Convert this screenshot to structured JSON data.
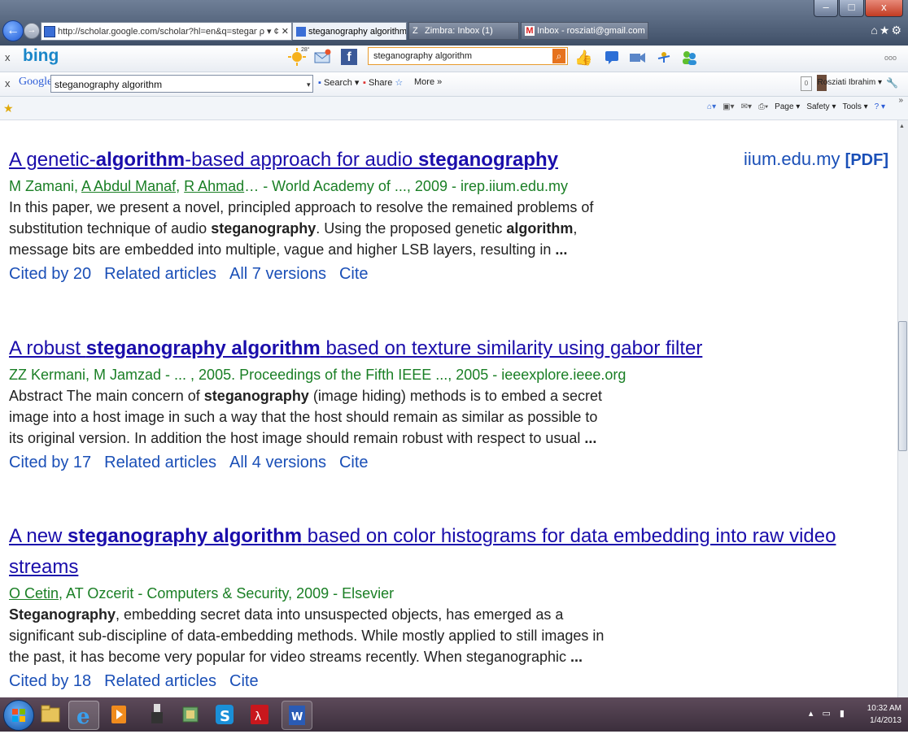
{
  "browser": {
    "address_url": "http://scholar.google.com/scholar?hl=en&q=steganography+alg",
    "address_controls": "ρ ▾ ¢ ✕",
    "tabs": [
      {
        "label": "steganography algorithm - ...",
        "active": true
      },
      {
        "label": "Zimbra: Inbox (1)",
        "active": false
      },
      {
        "label": "Inbox - rosziati@gmail.com - ...",
        "active": false
      }
    ],
    "window_controls": {
      "minimize": "–",
      "maximize": "□",
      "close": "x"
    }
  },
  "bing_toolbar": {
    "logo": "bing",
    "weather_temp": "28°",
    "search_value": "steganography algorithm",
    "close_label": "x",
    "more": "ooo"
  },
  "google_toolbar": {
    "close_label": "x",
    "logo": "Google",
    "search_value": "steganography algorithm",
    "search_label": "Search ▾",
    "share_label": "Share",
    "more_label": "More »",
    "user_name": "Rosziati Ibrahim ▾",
    "user_box": "0"
  },
  "command_bar": {
    "page": "Page ▾",
    "safety": "Safety ▾",
    "tools": "Tools ▾",
    "help": "? ▾"
  },
  "results": [
    {
      "title_parts": [
        "A genetic-",
        "algorithm",
        "-based approach for audio ",
        "steganography"
      ],
      "authors_parts": [
        "M Zamani, ",
        "A Abdul Manaf",
        ", ",
        "R Ahmad",
        "… - World Academy of ..., 2009 - irep.iium.edu.my"
      ],
      "snippet": [
        [
          "In this paper, we present a novel, principled approach to resolve the remained problems of"
        ],
        [
          "substitution technique of audio ",
          "steganography",
          ". Using the proposed genetic ",
          "algorithm",
          ","
        ],
        [
          "message bits are embedded into multiple, vague and higher LSB layers, resulting in ",
          "..."
        ]
      ],
      "links": [
        "Cited by 20",
        "Related articles",
        "All 7 versions",
        "Cite"
      ],
      "side": {
        "domain": "iium.edu.my",
        "tag": "[PDF]"
      }
    },
    {
      "title_parts": [
        "A robust ",
        "steganography algorithm",
        " based on texture similarity using gabor filter"
      ],
      "authors_parts": [
        "ZZ Kermani, M Jamzad - ... , 2005. Proceedings of the Fifth IEEE ..., 2005 - ieeexplore.ieee.org"
      ],
      "snippet": [
        [
          "Abstract The main concern of ",
          "steganography",
          " (image hiding) methods is to embed a secret"
        ],
        [
          "image into a host image in such a way that the host should remain as similar as possible to"
        ],
        [
          "its original version. In addition the host image should remain robust with respect to usual ",
          "..."
        ]
      ],
      "links": [
        "Cited by 17",
        "Related articles",
        "All 4 versions",
        "Cite"
      ]
    },
    {
      "title_parts": [
        "A new ",
        "steganography algorithm",
        " based on color histograms for data embedding into raw video"
      ],
      "title_line2": "streams",
      "authors_parts": [
        "O Cetin",
        ", AT Ozcerit - Computers & Security, 2009 - Elsevier"
      ],
      "snippet": [
        [
          "Steganography",
          ", embedding secret data into unsuspected objects, has emerged as a"
        ],
        [
          "significant sub-discipline of data-embedding methods. While mostly applied to still images in"
        ],
        [
          "the past, it has become very popular for video streams recently. When steganographic ",
          "..."
        ]
      ],
      "links": [
        "Cited by 18",
        "Related articles",
        "Cite"
      ]
    }
  ],
  "taskbar": {
    "time": "10:32 AM",
    "date": "1/4/2013",
    "apps": [
      "windows-explorer",
      "internet-explorer",
      "media-player",
      "usb-drive",
      "cabinet-file",
      "skype",
      "adobe-reader",
      "microsoft-word"
    ]
  }
}
